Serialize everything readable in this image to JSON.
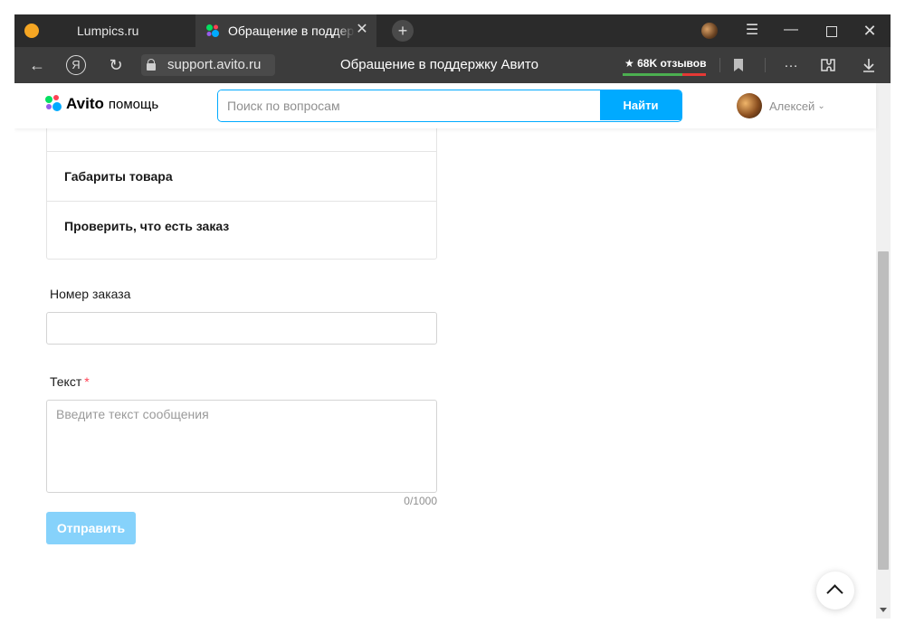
{
  "browser": {
    "tabs": [
      {
        "label": "Lumpics.ru",
        "active": false
      },
      {
        "label": "Обращение в поддержку",
        "active": true
      }
    ],
    "address": {
      "url": "support.avito.ru",
      "page_title": "Обращение в поддержку Авито",
      "reviews_badge": "★ 68K отзывов"
    }
  },
  "site": {
    "logo_brand": "Avito",
    "logo_suffix": "помощь",
    "search": {
      "placeholder": "Поиск по вопросам",
      "button_label": "Найти"
    },
    "user_name": "Алексей"
  },
  "form": {
    "options": [
      {
        "label": "Габариты товара"
      },
      {
        "label": "Проверить, что есть заказ"
      }
    ],
    "order_field": {
      "label": "Номер заказа",
      "value": ""
    },
    "text_field": {
      "label": "Текст",
      "required_mark": "*",
      "placeholder": "Введите текст сообщения",
      "counter": "0/1000"
    },
    "submit_label": "Отправить"
  },
  "colors": {
    "accent": "#00aaff",
    "submit_disabled": "#86d2fb",
    "required": "#ff4053"
  }
}
